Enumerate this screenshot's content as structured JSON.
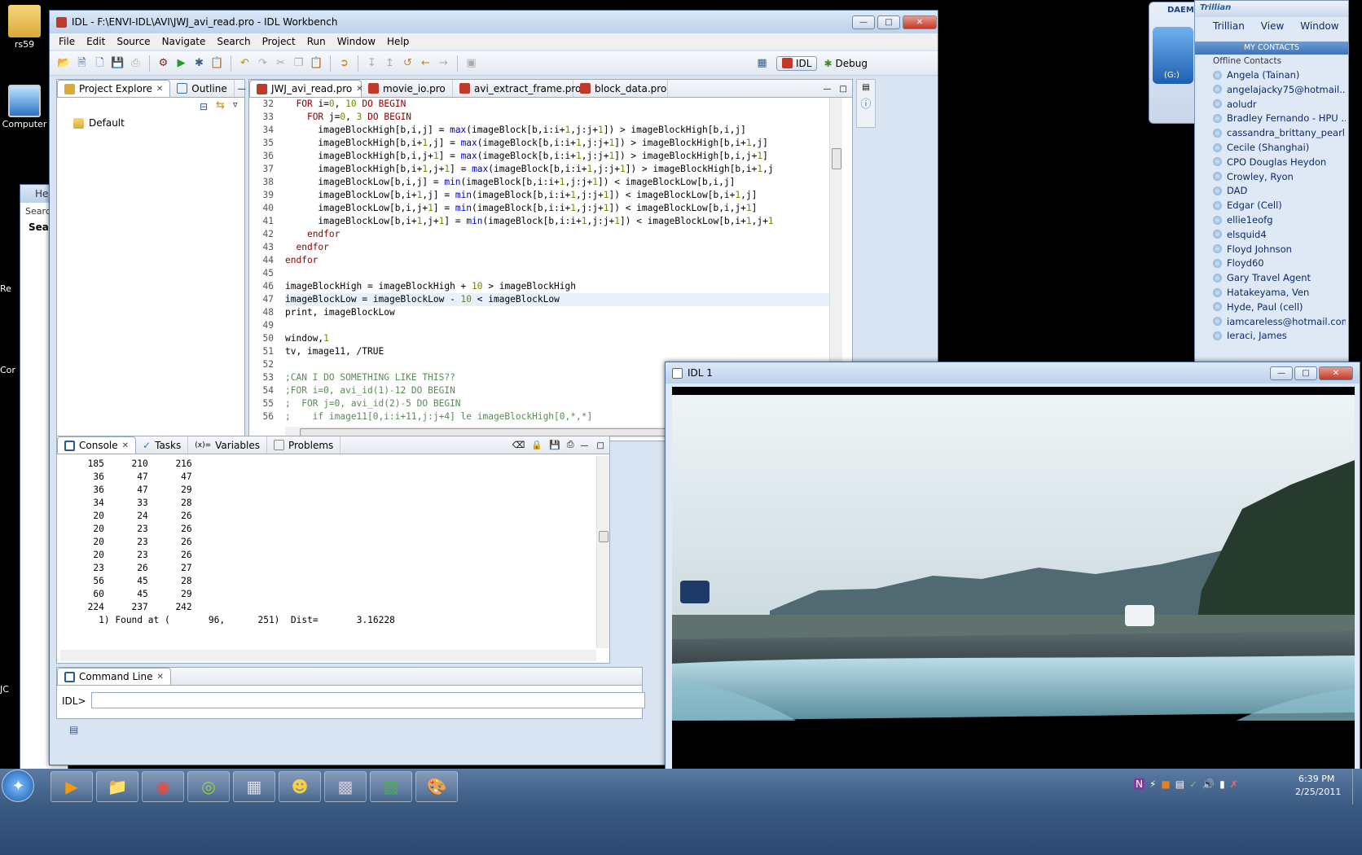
{
  "desktop": {
    "icons": [
      {
        "label": "rs59"
      },
      {
        "label": "Computer"
      }
    ],
    "background_partial_window": {
      "title_fragment": "He",
      "search_fragment": "Searc",
      "header_fragment": "Sea"
    },
    "left_edge_fragments": [
      "Re",
      "Cor",
      "JC"
    ]
  },
  "idl_workbench": {
    "title": "IDL - F:\\ENVI-IDL\\AVI\\JWJ_avi_read.pro - IDL Workbench",
    "menu": [
      "File",
      "Edit",
      "Source",
      "Navigate",
      "Search",
      "Project",
      "Run",
      "Window",
      "Help"
    ],
    "perspectives": {
      "idl": "IDL",
      "debug": "Debug"
    },
    "project_tabs": [
      {
        "label": "Project Explore"
      },
      {
        "label": "Outline"
      }
    ],
    "project_tree": [
      "Default"
    ],
    "editor_tabs": [
      "JWJ_avi_read.pro",
      "movie_io.pro",
      "avi_extract_frame.pro",
      "block_data.pro"
    ],
    "editor_line_numbers": [
      "32",
      "33",
      "34",
      "35",
      "36",
      "37",
      "38",
      "39",
      "40",
      "41",
      "42",
      "43",
      "44",
      "45",
      "46",
      "47",
      "48",
      "49",
      "50",
      "51",
      "52",
      "53",
      "54",
      "55",
      "56"
    ],
    "code_lines": [
      "  FOR i=0, 10 DO BEGIN",
      "    FOR j=0, 3 DO BEGIN",
      "      imageBlockHigh[b,i,j] = max(imageBlock[b,i:i+1,j:j+1]) > imageBlockHigh[b,i,j]",
      "      imageBlockHigh[b,i+1,j] = max(imageBlock[b,i:i+1,j:j+1]) > imageBlockHigh[b,i+1,j]",
      "      imageBlockHigh[b,i,j+1] = max(imageBlock[b,i:i+1,j:j+1]) > imageBlockHigh[b,i,j+1]",
      "      imageBlockHigh[b,i+1,j+1] = max(imageBlock[b,i:i+1,j:j+1]) > imageBlockHigh[b,i+1,j",
      "      imageBlockLow[b,i,j] = min(imageBlock[b,i:i+1,j:j+1]) < imageBlockLow[b,i,j]",
      "      imageBlockLow[b,i+1,j] = min(imageBlock[b,i:i+1,j:j+1]) < imageBlockLow[b,i+1,j]",
      "      imageBlockLow[b,i,j+1] = min(imageBlock[b,i:i+1,j:j+1]) < imageBlockLow[b,i,j+1]",
      "      imageBlockLow[b,i+1,j+1] = min(imageBlock[b,i:i+1,j:j+1]) < imageBlockLow[b,i+1,j+1",
      "    endfor",
      "  endfor",
      "endfor",
      "",
      "imageBlockHigh = imageBlockHigh + 10 > imageBlockHigh",
      "imageBlockLow = imageBlockLow - 10 < imageBlockLow",
      "print, imageBlockLow",
      "",
      "window,1",
      "tv, image11, /TRUE",
      "",
      ";CAN I DO SOMETHING LIKE THIS??",
      ";FOR i=0, avi_id(1)-12 DO BEGIN",
      ";  FOR j=0, avi_id(2)-5 DO BEGIN",
      ";    if image11[0,i:i+11,j:j+4] le imageBlockHigh[0,*,*]"
    ],
    "bottom_tabs": [
      "Console",
      "Tasks",
      "Variables",
      "Problems"
    ],
    "console_lines": [
      "     185     210     216",
      "      36      47      47",
      "      36      47      29",
      "      34      33      28",
      "      20      24      26",
      "      20      23      26",
      "      20      23      26",
      "      20      23      26",
      "      23      26      27",
      "      56      45      28",
      "      60      45      29",
      "     224     237     242",
      "       1) Found at (       96,      251)  Dist=       3.16228"
    ],
    "command_line": {
      "tab": "Command Line",
      "prompt": "IDL>",
      "value": ""
    }
  },
  "idl_window": {
    "title": "IDL 1"
  },
  "daemon": {
    "label": "DAEM",
    "drive": "(G:)"
  },
  "trillian": {
    "brand": "Trillian",
    "menu": [
      "Trillian",
      "View",
      "Window"
    ],
    "section": "MY CONTACTS",
    "group": "Offline Contacts",
    "contacts": [
      "Angela (Tainan)",
      "angelajacky75@hotmail....",
      "aoludr",
      "Bradley Fernando - HPU ...",
      "cassandra_brittany_pearl...",
      "Cecile (Shanghai)",
      "CPO Douglas Heydon",
      "Crowley, Ryon",
      "DAD",
      "Edgar (Cell)",
      "ellie1eofg",
      "elsquid4",
      "Floyd Johnson",
      "Floyd60",
      "Gary Travel Agent",
      "Hatakeyama, Ven",
      "Hyde, Paul (cell)",
      "iamcareless@hotmail.com",
      "Ieraci, James"
    ]
  },
  "taskbar": {
    "time": "6:39 PM",
    "date": "2/25/2011"
  },
  "colors": {
    "taskbar": "#3c5c84",
    "keyword": "#8b0000",
    "function": "#0000c0",
    "number": "#6a8a00",
    "comment": "#5a8a5a"
  }
}
